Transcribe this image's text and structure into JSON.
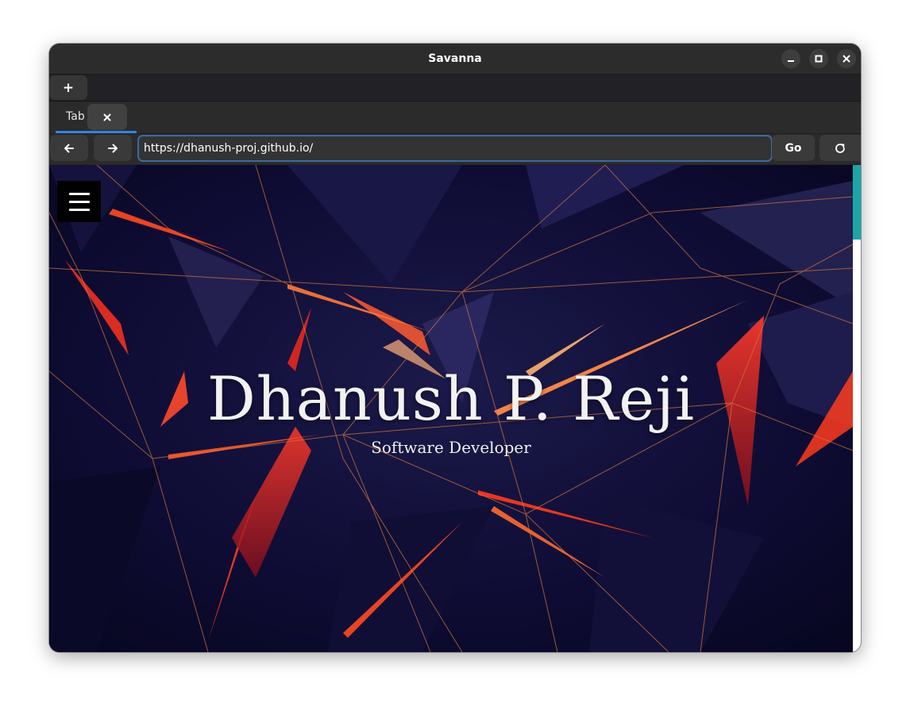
{
  "window": {
    "title": "Savanna",
    "controls": [
      "minimize-icon",
      "maximize-icon",
      "close-icon"
    ]
  },
  "tabs": {
    "new_tab_label": "+",
    "items": [
      {
        "label": "Tab",
        "close_label": "×",
        "active": true
      }
    ]
  },
  "navbar": {
    "back_icon": "arrow-left-icon",
    "forward_icon": "arrow-right-icon",
    "url": "https://dhanush-proj.github.io/",
    "go_label": "Go",
    "reload_icon": "reload-icon"
  },
  "page": {
    "menu_icon": "hamburger-menu-icon",
    "name": "Dhanush P. Reji",
    "subtitle": "Software Developer",
    "colors": {
      "background": "#0c0a2e",
      "accent_red": "#ff3b1f",
      "accent_orange": "#ff9a3c",
      "scroll_thumb": "#1aa6a6",
      "url_focus": "#3d6ba3",
      "tab_indicator": "#3584e4"
    }
  }
}
